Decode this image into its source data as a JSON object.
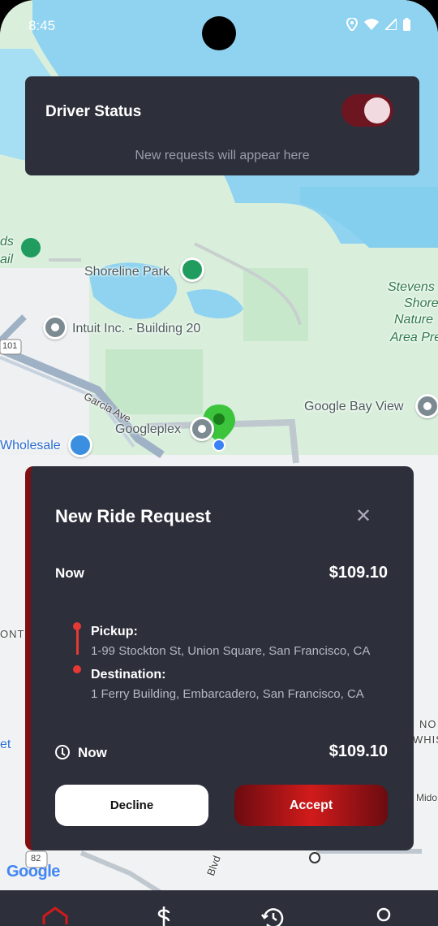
{
  "status_bar": {
    "time": "8:45"
  },
  "driver_status": {
    "title": "Driver Status",
    "hint": "New requests will appear here",
    "online": true
  },
  "map": {
    "labels": {
      "shoreline_park": "Shoreline Park",
      "intuit": "Intuit Inc. - Building 20",
      "garcia_ave": "Garcia Ave",
      "googleplex": "Googleplex",
      "google_bay_view": "Google Bay View",
      "wholesale": "Wholesale",
      "stevens": "Stevens",
      "shore": "Shore",
      "nature": "Nature",
      "area_pre": "Area Pre",
      "ds": "ds",
      "ail": "ail",
      "highway_101": "101",
      "highway_82": "82",
      "ont": "ONT",
      "no": "NO",
      "whis": "WHIS",
      "et": "et",
      "mido": "Mido",
      "blvd": "Blvd"
    },
    "attribution": "Google"
  },
  "ride_request": {
    "title": "New Ride Request",
    "time_label": "Now",
    "price": "$109.10",
    "pickup_label": "Pickup:",
    "pickup_address": "1-99 Stockton St, Union Square, San Francisco, CA",
    "destination_label": "Destination:",
    "destination_address": "1 Ferry Building, Embarcadero, San Francisco, CA",
    "footer_time": "Now",
    "footer_price": "$109.10",
    "decline_label": "Decline",
    "accept_label": "Accept"
  },
  "colors": {
    "card_bg": "#2d2f3b",
    "accent_red": "#d11b1b",
    "route_red": "#e53935"
  },
  "bottom_nav": {
    "items": [
      "home-icon",
      "dollar-icon",
      "history-icon",
      "profile-icon"
    ]
  }
}
